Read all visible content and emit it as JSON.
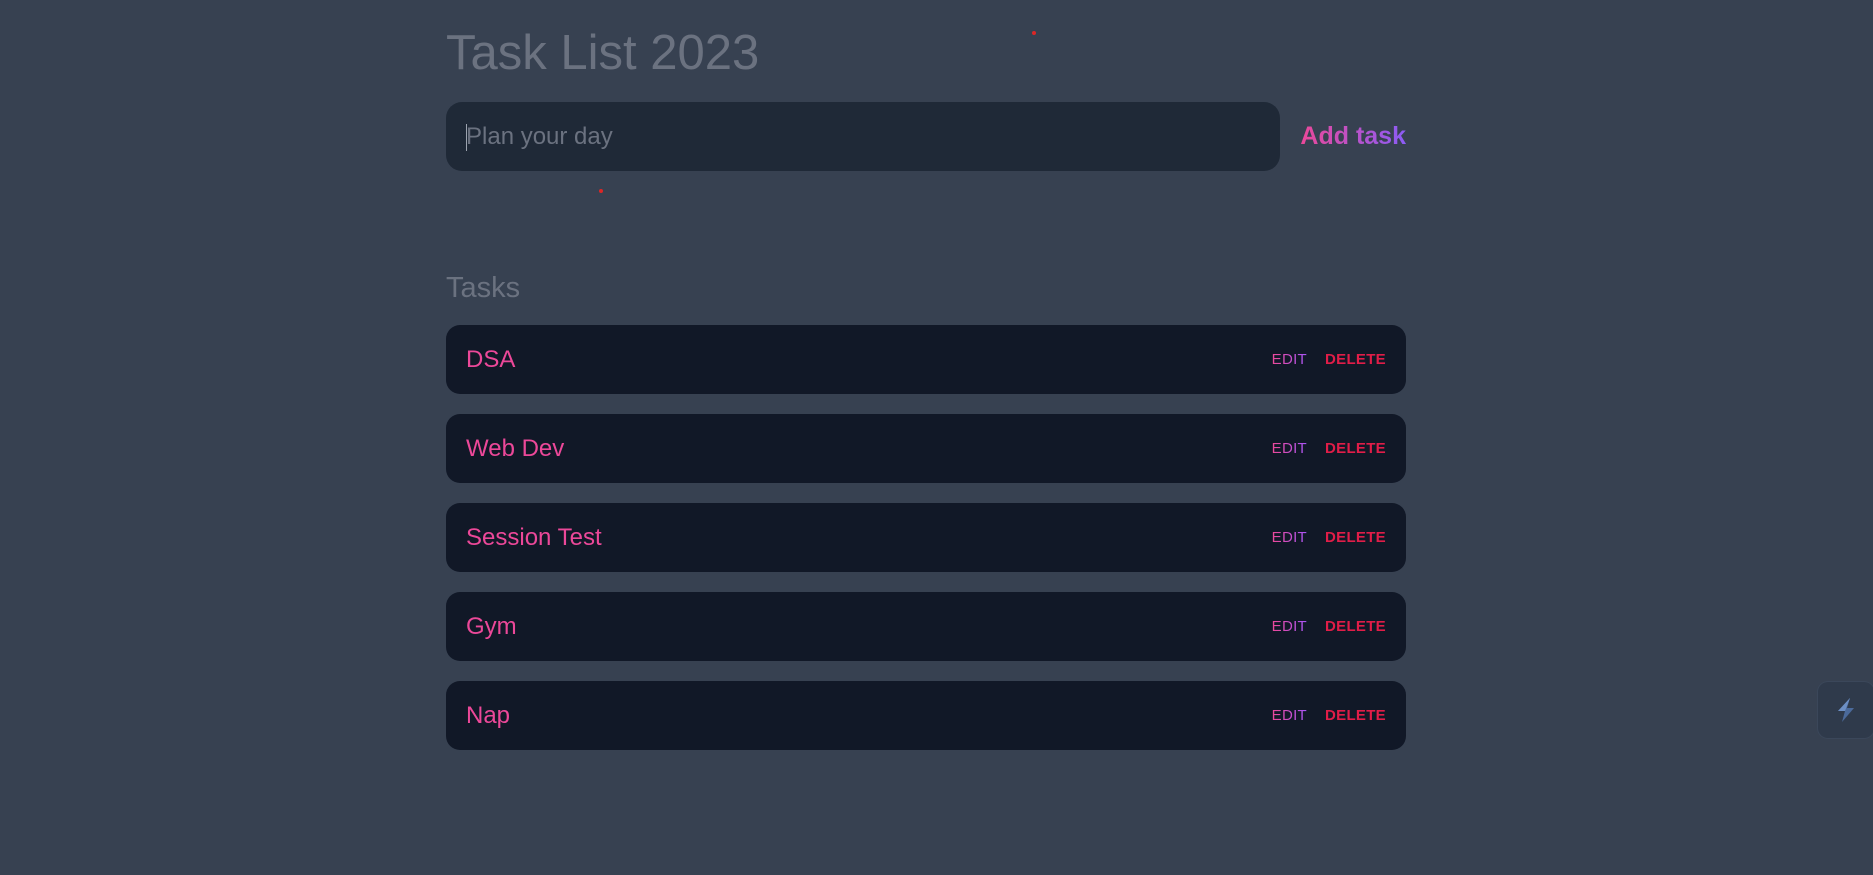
{
  "header": {
    "title": "Task List 2023"
  },
  "new_task": {
    "placeholder": "Plan your day",
    "value": "",
    "add_label": "Add task"
  },
  "tasks_section": {
    "title": "Tasks",
    "edit_label": "EDIT",
    "delete_label": "DELETE",
    "items": [
      {
        "name": "DSA"
      },
      {
        "name": "Web Dev"
      },
      {
        "name": "Session Test"
      },
      {
        "name": "Gym"
      },
      {
        "name": "Nap"
      }
    ]
  },
  "widget": {
    "icon": "lightning-bolt-icon"
  },
  "colors": {
    "background": "#374151",
    "input_bg": "#1f2937",
    "row_bg": "#111827",
    "accent_pink": "#ec4899",
    "accent_purple": "#8b5cf6",
    "delete_red": "#e11d48",
    "muted_text": "#6b7280"
  }
}
